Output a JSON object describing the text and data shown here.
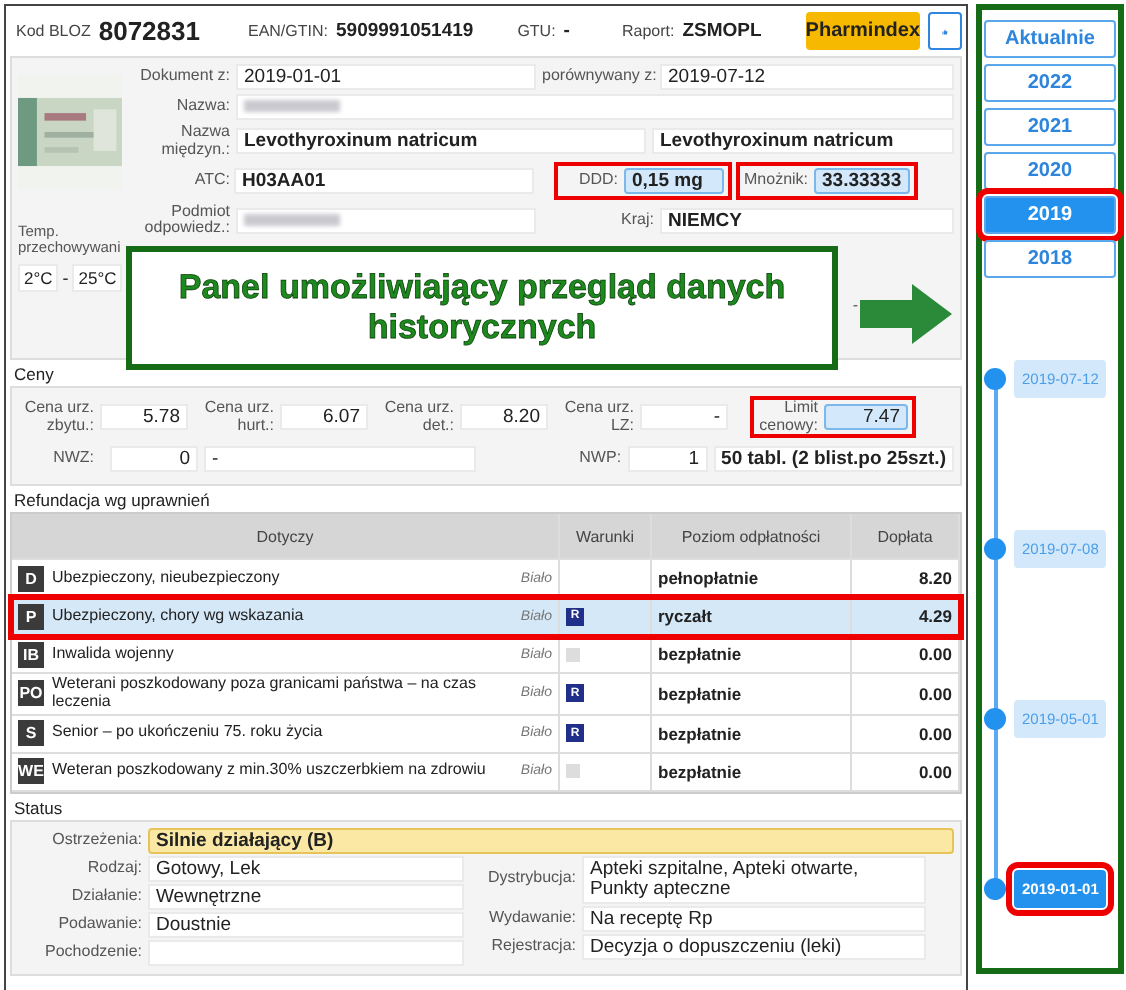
{
  "header": {
    "bloz_label": "Kod BLOZ",
    "bloz": "8072831",
    "ean_label": "EAN/GTIN:",
    "ean": "5909991051419",
    "gtu_label": "GTU:",
    "gtu": "-",
    "report_label": "Raport:",
    "report": "ZSMOPL",
    "button": "Pharmindex"
  },
  "product": {
    "document": {
      "label": "Dokument z:",
      "value": "2019-01-01"
    },
    "compared": {
      "label": "porównywany z:",
      "value": "2019-07-12"
    },
    "name": {
      "label": "Nazwa:",
      "redacted": true
    },
    "international_name": {
      "label": "Nazwa międzyn.:",
      "value": "Levothyroxinum natricum",
      "compared_value": "Levothyroxinum natricum"
    },
    "atc": {
      "label": "ATC:",
      "value": "H03AA01"
    },
    "ddd": {
      "label": "DDD:",
      "value": "0,15 mg",
      "highlighted": true
    },
    "multiplier": {
      "label": "Mnożnik:",
      "value": "33.33333",
      "highlighted": true
    },
    "holder": {
      "label": "Podmiot odpowiedz.:",
      "redacted": true
    },
    "country": {
      "label": "Kraj:",
      "value": "NIEMCY"
    },
    "storage": {
      "label": "Temp. przechowywani",
      "min": "2°C",
      "separator": "-",
      "max": "25°C"
    },
    "extra_value": "-"
  },
  "callout": {
    "text": "Panel umożliwiający przegląd danych historycznych"
  },
  "prices": {
    "title": "Ceny",
    "fields": [
      {
        "label": "Cena urz. zbytu.:",
        "value": "5.78",
        "highlighted": false
      },
      {
        "label": "Cena urz. hurt.:",
        "value": "6.07",
        "highlighted": false
      },
      {
        "label": "Cena urz. det.:",
        "value": "8.20",
        "highlighted": false
      },
      {
        "label": "Cena urz. LZ:",
        "value": "-",
        "highlighted": false
      },
      {
        "label": "Limit cenowy:",
        "value": "7.47",
        "highlighted": true
      }
    ],
    "nwz": {
      "label": "NWZ:",
      "value": "0",
      "note": "-"
    },
    "nwp": {
      "label": "NWP:",
      "value": "1",
      "package": "50 tabl. (2 blist.po 25szt.)"
    }
  },
  "refund": {
    "title": "Refundacja wg uprawnień",
    "columns": [
      "Dotyczy",
      "Warunki",
      "Poziom odpłatności",
      "Dopłata"
    ],
    "rows": [
      {
        "code": "D",
        "name": "Ubezpieczony, nieubezpieczony",
        "list": "Biało",
        "level": "pełnopłatnie",
        "payment": "8.20",
        "selected": false,
        "highlighted": false
      },
      {
        "code": "P",
        "name": "Ubezpieczony, chory wg wskazania",
        "list": "Biało",
        "condition": {
          "kind": "badge",
          "text": "R"
        },
        "level": "ryczałt",
        "payment": "4.29",
        "selected": true,
        "highlighted": true
      },
      {
        "code": "IB",
        "name": "Inwalida wojenny",
        "list": "Biało",
        "condition": {
          "kind": "blank"
        },
        "level": "bezpłatnie",
        "payment": "0.00",
        "selected": false,
        "highlighted": false
      },
      {
        "code": "PO",
        "name": "Weterani poszkodowany poza granicami państwa – na czas leczenia",
        "list": "Biało",
        "condition": {
          "kind": "badge",
          "text": "R"
        },
        "level": "bezpłatnie",
        "payment": "0.00",
        "selected": false,
        "highlighted": false
      },
      {
        "code": "S",
        "name": "Senior – po ukończeniu 75. roku życia",
        "list": "Biało",
        "condition": {
          "kind": "badge",
          "text": "R"
        },
        "level": "bezpłatnie",
        "payment": "0.00",
        "selected": false,
        "highlighted": false
      },
      {
        "code": "WE",
        "name": "Weteran poszkodowany z min.30% uszczerbkiem na zdrowiu",
        "list": "Biało",
        "condition": {
          "kind": "blank"
        },
        "level": "bezpłatnie",
        "payment": "0.00",
        "selected": false,
        "highlighted": false
      }
    ]
  },
  "status": {
    "title": "Status",
    "warning": {
      "label": "Ostrzeżenia:",
      "value": "Silnie działający (B)"
    },
    "left": [
      {
        "label": "Rodzaj:",
        "value": "Gotowy, Lek"
      },
      {
        "label": "Działanie:",
        "value": "Wewnętrzne"
      },
      {
        "label": "Podawanie:",
        "value": "Doustnie"
      },
      {
        "label": "Pochodzenie:"
      }
    ],
    "right": [
      {
        "label": "Dystrybucja:",
        "value": "Apteki szpitalne, Apteki otwarte, Punkty apteczne"
      },
      {
        "label": "Wydawanie:",
        "value": "Na receptę Rp"
      },
      {
        "label": "Rejestracja:",
        "value": "Decyzja o dopuszczeniu (leki)"
      }
    ]
  },
  "history": {
    "years": [
      {
        "label": "Aktualnie",
        "selected": false,
        "highlighted": false
      },
      {
        "label": "2022",
        "selected": false,
        "highlighted": false
      },
      {
        "label": "2021",
        "selected": false,
        "highlighted": false
      },
      {
        "label": "2020",
        "selected": false,
        "highlighted": false
      },
      {
        "label": "2019",
        "selected": true,
        "highlighted": true
      },
      {
        "label": "2018",
        "selected": false,
        "highlighted": false
      }
    ],
    "dates": [
      {
        "label": "2019-07-12",
        "selected": false,
        "highlighted": false
      },
      {
        "label": "2019-07-08",
        "selected": false,
        "highlighted": false
      },
      {
        "label": "2019-05-01",
        "selected": false,
        "highlighted": false
      },
      {
        "label": "2019-01-01",
        "selected": true,
        "highlighted": true
      }
    ]
  }
}
